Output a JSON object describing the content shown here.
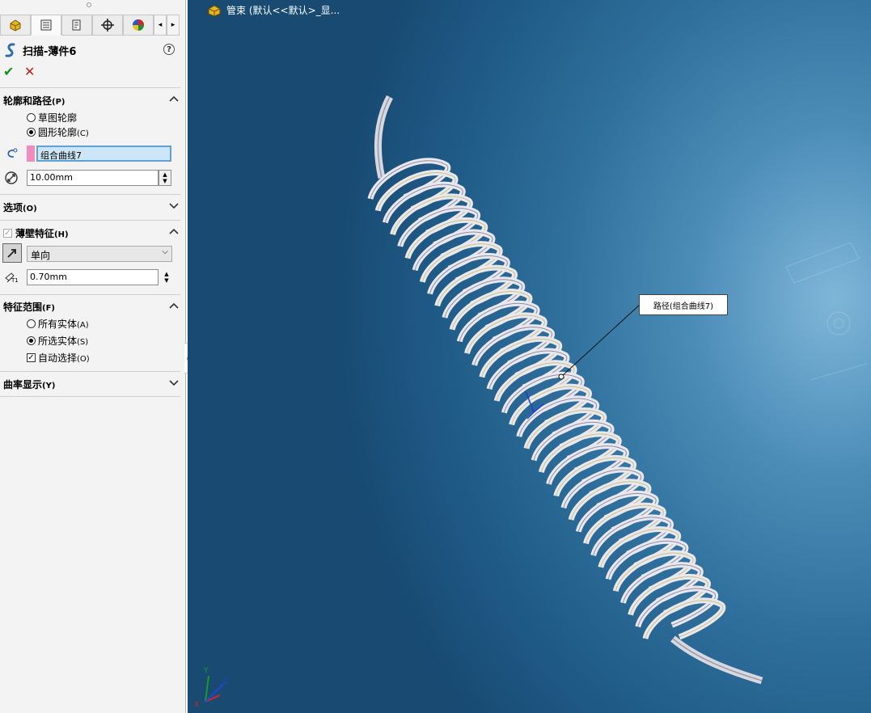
{
  "panel": {
    "tabs": [
      "part-icon",
      "feature-manager-icon",
      "property-manager-icon",
      "configuration-manager-icon",
      "display-manager-icon"
    ],
    "nav_prev": "◂",
    "nav_next": "▸",
    "title": "扫描-薄件6",
    "help": "?",
    "ok": "✔",
    "cancel": "✕",
    "profile_path": {
      "heading": "轮廓和路径",
      "heading_key": "(P)",
      "option_sketch": "草图轮廓",
      "option_circle": "圆形轮廓",
      "option_circle_key": "(C)",
      "path_value": "组合曲线7",
      "diameter_value": "10.00mm"
    },
    "options": {
      "heading": "选项",
      "key": "(O)"
    },
    "thin_feature": {
      "heading": "薄壁特征",
      "key": "(H)",
      "direction_value": "单向",
      "thickness_value": "0.70mm",
      "t_label": "T1"
    },
    "feature_scope": {
      "heading": "特征范围",
      "key": "(F)",
      "all_bodies": "所有实体",
      "all_bodies_key": "(A)",
      "selected_bodies": "所选实体",
      "selected_bodies_key": "(S)",
      "auto_select": "自动选择",
      "auto_select_key": "(O)"
    },
    "curvature": {
      "heading": "曲率显示",
      "key": "(Y)"
    }
  },
  "viewport": {
    "breadcrumb": "管束 (默认<<默认>_显...",
    "callout": "路径(组合曲线7)",
    "triad": {
      "x": "X",
      "y": "Y",
      "z": "Z"
    }
  },
  "colors": {
    "accent_green": "#1a8f1a",
    "cancel_red": "#c0201c",
    "field_selected": "#cde6f7",
    "pink_swatch": "#f08cc0"
  }
}
